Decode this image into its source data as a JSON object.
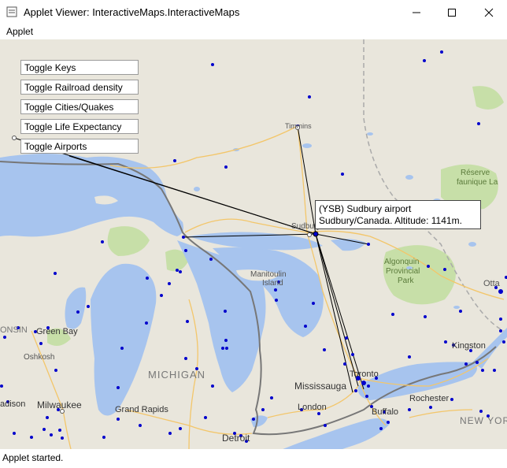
{
  "window": {
    "title": "Applet Viewer: InteractiveMaps.InteractiveMaps",
    "controls": {
      "minimize": "minimize-icon",
      "maximize": "maximize-icon",
      "close": "close-icon"
    }
  },
  "menu": {
    "items": [
      "Applet"
    ]
  },
  "toggles": [
    "Toggle Keys",
    "Toggle Railroad density",
    "Toggle Cities/Quakes",
    "Toggle Life Expectancy",
    "Toggle Airports"
  ],
  "tooltip": {
    "line1": "(YSB) Sudbury airport",
    "line2": "Sudbury/Canada. Altitude: 1141m."
  },
  "map_labels": {
    "timmins": "Timmins",
    "reserve_faunique": "Réserve",
    "reserve_faunique2": "faunique La",
    "sudbury": "Sudbury",
    "algonquin1": "Algonquin",
    "algonquin2": "Provincial",
    "algonquin3": "Park",
    "manitoulin1": "Manitoulin",
    "manitoulin2": "Island",
    "ottawa": "Otta",
    "green_bay": "Green Bay",
    "onsin": "ONSIN",
    "oshkosh": "Oshkosh",
    "michigan": "MICHIGAN",
    "kingston": "Kingston",
    "toronto": "Toronto",
    "mississauga": "Mississauga",
    "rochester": "Rochester",
    "adison": "adison",
    "milwaukee": "Milwaukee",
    "grand_rapids": "Grand Rapids",
    "london": "London",
    "buffalo": "Buffalo",
    "new_york": "NEW YOR",
    "detroit": "Detroit"
  },
  "colors": {
    "water": "#a7c4ee",
    "land": "#e9e6dc",
    "park": "#c7dfa8",
    "airport": "#0000cc",
    "border": "#777777"
  },
  "status": {
    "text": "Applet started."
  }
}
